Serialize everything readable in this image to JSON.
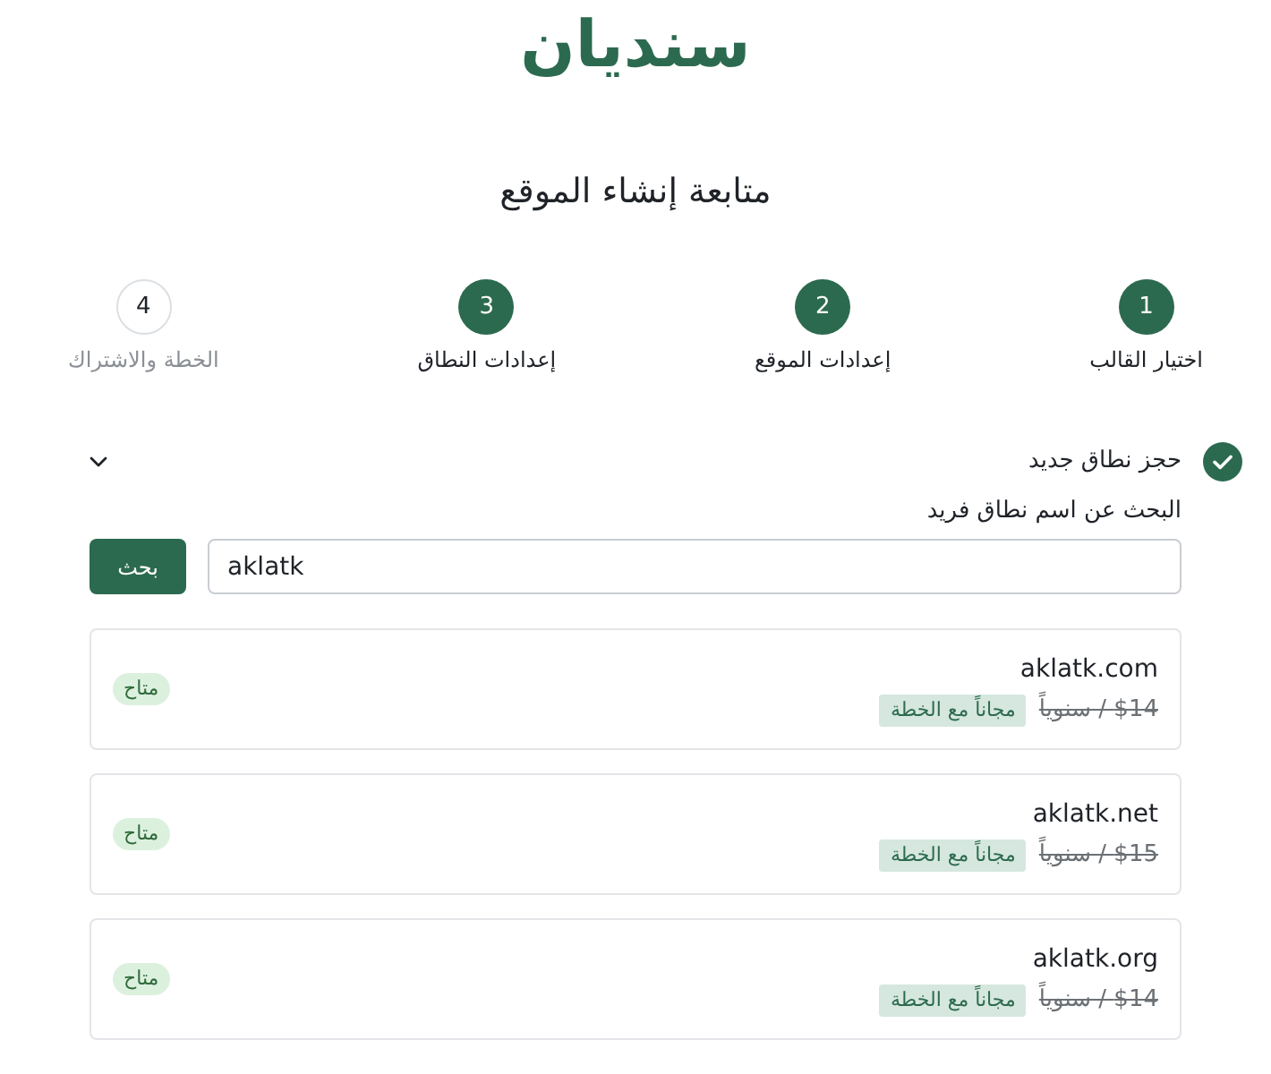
{
  "logo": "سنديان",
  "title": "متابعة إنشاء الموقع",
  "steps": [
    {
      "number": "1",
      "label": "اختيار القالب",
      "done": true
    },
    {
      "number": "2",
      "label": "إعدادات الموقع",
      "done": true
    },
    {
      "number": "3",
      "label": "إعدادات النطاق",
      "done": true
    },
    {
      "number": "4",
      "label": "الخطة والاشتراك",
      "done": false
    }
  ],
  "section": {
    "title": "حجز نطاق جديد",
    "completed": true
  },
  "search": {
    "label": "البحث عن اسم نطاق فريد",
    "value": "aklatk",
    "button": "بحث"
  },
  "results": [
    {
      "domain": "aklatk.com",
      "price": "$14 / سنوياً",
      "offer": "مجاناً مع الخطة",
      "status": "متاح"
    },
    {
      "domain": "aklatk.net",
      "price": "$15 / سنوياً",
      "offer": "مجاناً مع الخطة",
      "status": "متاح"
    },
    {
      "domain": "aklatk.org",
      "price": "$14 / سنوياً",
      "offer": "مجاناً مع الخطة",
      "status": "متاح"
    }
  ]
}
